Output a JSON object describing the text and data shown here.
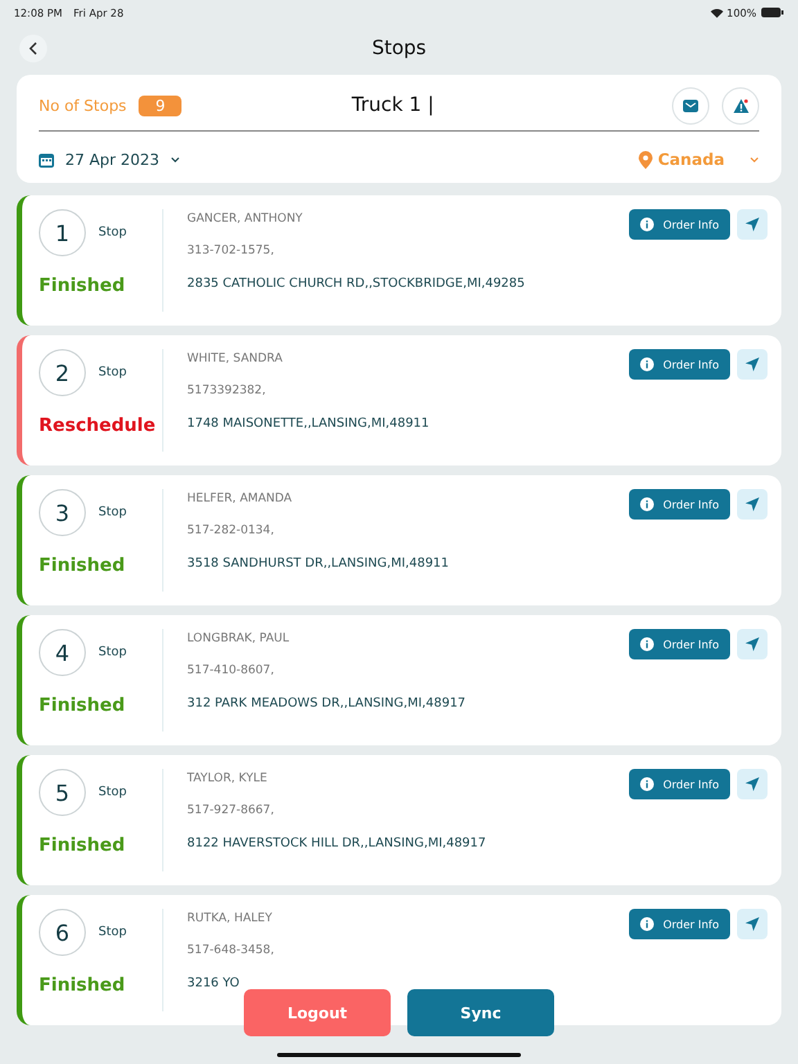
{
  "status_bar": {
    "time": "12:08 PM",
    "date": "Fri Apr 28",
    "battery": "100%"
  },
  "header": {
    "title": "Stops"
  },
  "summary": {
    "stops_label": "No of Stops",
    "stops_count": "9",
    "truck": "Truck 1 |",
    "date": "27 Apr 2023",
    "country": "Canada"
  },
  "stops": [
    {
      "number": "1",
      "stop_label": "Stop",
      "status": "Finished",
      "kind": "finished",
      "name": "GANCER, ANTHONY",
      "phone": "313-702-1575,",
      "address": "2835 CATHOLIC CHURCH RD,,STOCKBRIDGE,MI,49285",
      "order_button": "Order Info"
    },
    {
      "number": "2",
      "stop_label": "Stop",
      "status": "Reschedule",
      "kind": "reschedule",
      "name": "WHITE, SANDRA",
      "phone": "5173392382,",
      "address": "1748 MAISONETTE,,LANSING,MI,48911",
      "order_button": "Order Info"
    },
    {
      "number": "3",
      "stop_label": "Stop",
      "status": "Finished",
      "kind": "finished",
      "name": "HELFER, AMANDA",
      "phone": "517-282-0134,",
      "address": "3518 SANDHURST DR,,LANSING,MI,48911",
      "order_button": "Order Info"
    },
    {
      "number": "4",
      "stop_label": "Stop",
      "status": "Finished",
      "kind": "finished",
      "name": "LONGBRAK, PAUL",
      "phone": "517-410-8607,",
      "address": "312 PARK MEADOWS DR,,LANSING,MI,48917",
      "order_button": "Order Info"
    },
    {
      "number": "5",
      "stop_label": "Stop",
      "status": "Finished",
      "kind": "finished",
      "name": "TAYLOR, KYLE",
      "phone": "517-927-8667,",
      "address": "8122 HAVERSTOCK HILL DR,,LANSING,MI,48917",
      "order_button": "Order Info"
    },
    {
      "number": "6",
      "stop_label": "Stop",
      "status": "Finished",
      "kind": "finished",
      "name": "RUTKA, HALEY",
      "phone": "517-648-3458,",
      "address": "3216 YO",
      "order_button": "Order Info"
    }
  ],
  "buttons": {
    "logout": "Logout",
    "sync": "Sync"
  }
}
